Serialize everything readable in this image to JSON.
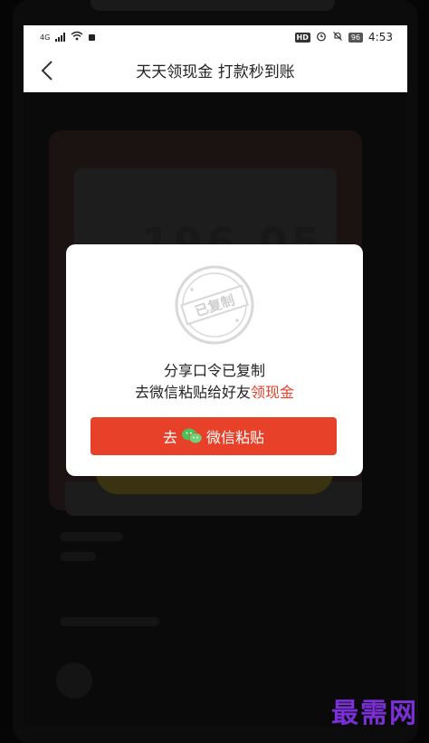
{
  "status_bar": {
    "time": "4:53",
    "battery": "96",
    "hd_badge": "HD",
    "signal_label": "4G"
  },
  "nav": {
    "title": "天天领现金 打款秒到账"
  },
  "background": {
    "amount_hint": "196.05"
  },
  "modal": {
    "stamp_text": "已复制",
    "line1": "分享口令已复制",
    "line2_prefix": "去微信粘贴给好友",
    "line2_highlight": "领现金",
    "button_prefix": "去",
    "button_suffix": "微信粘贴"
  },
  "watermark": {
    "text": "最需网"
  },
  "colors": {
    "accent": "#e8412a",
    "watermark": "#7b2fd6",
    "wechat_green": "#4cc15a"
  }
}
